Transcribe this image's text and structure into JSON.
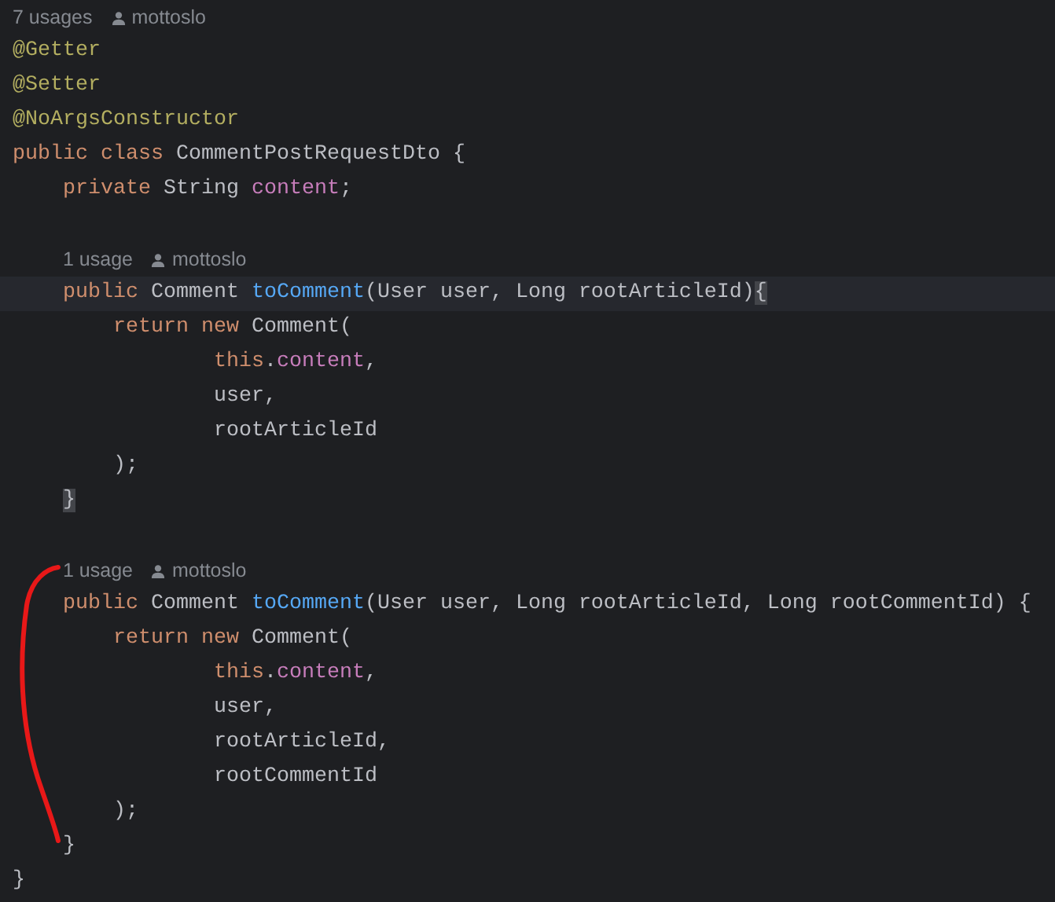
{
  "lines": [
    {
      "kind": "hint",
      "indented": false,
      "usages": "7 usages",
      "author": "mottoslo"
    },
    {
      "kind": "code",
      "current": false,
      "tokens": [
        {
          "kind": "annotation",
          "text": "@Getter",
          "matched": false
        }
      ]
    },
    {
      "kind": "code",
      "current": false,
      "tokens": [
        {
          "kind": "annotation",
          "text": "@Setter",
          "matched": false
        }
      ]
    },
    {
      "kind": "code",
      "current": false,
      "tokens": [
        {
          "kind": "annotation",
          "text": "@NoArgsConstructor",
          "matched": false
        }
      ]
    },
    {
      "kind": "code",
      "current": false,
      "tokens": [
        {
          "kind": "keyword",
          "text": "public class ",
          "matched": false
        },
        {
          "kind": "plain",
          "text": "CommentPostRequestDto {",
          "matched": false
        }
      ]
    },
    {
      "kind": "code",
      "current": false,
      "tokens": [
        {
          "kind": "keyword",
          "text": "    private ",
          "matched": false
        },
        {
          "kind": "plain",
          "text": "String ",
          "matched": false
        },
        {
          "kind": "field",
          "text": "content",
          "matched": false
        },
        {
          "kind": "plain",
          "text": ";",
          "matched": false
        }
      ]
    },
    {
      "kind": "blank"
    },
    {
      "kind": "hint",
      "indented": true,
      "usages": "1 usage",
      "author": "mottoslo"
    },
    {
      "kind": "code",
      "current": true,
      "tokens": [
        {
          "kind": "keyword",
          "text": "    public ",
          "matched": false
        },
        {
          "kind": "plain",
          "text": "Comment ",
          "matched": false
        },
        {
          "kind": "method",
          "text": "toComment",
          "matched": false
        },
        {
          "kind": "plain",
          "text": "(User user, Long rootArticleId)",
          "matched": false
        },
        {
          "kind": "plain",
          "text": "{",
          "matched": true
        }
      ]
    },
    {
      "kind": "code",
      "current": false,
      "tokens": [
        {
          "kind": "keyword",
          "text": "        return new ",
          "matched": false
        },
        {
          "kind": "plain",
          "text": "Comment(",
          "matched": false
        }
      ]
    },
    {
      "kind": "code",
      "current": false,
      "tokens": [
        {
          "kind": "keyword",
          "text": "                this",
          "matched": false
        },
        {
          "kind": "plain",
          "text": ".",
          "matched": false
        },
        {
          "kind": "field",
          "text": "content",
          "matched": false
        },
        {
          "kind": "plain",
          "text": ",",
          "matched": false
        }
      ]
    },
    {
      "kind": "code",
      "current": false,
      "tokens": [
        {
          "kind": "plain",
          "text": "                user,",
          "matched": false
        }
      ]
    },
    {
      "kind": "code",
      "current": false,
      "tokens": [
        {
          "kind": "plain",
          "text": "                rootArticleId",
          "matched": false
        }
      ]
    },
    {
      "kind": "code",
      "current": false,
      "tokens": [
        {
          "kind": "plain",
          "text": "        );",
          "matched": false
        }
      ]
    },
    {
      "kind": "code",
      "current": false,
      "tokens": [
        {
          "kind": "plain",
          "text": "    }",
          "matched": true
        }
      ]
    },
    {
      "kind": "blank"
    },
    {
      "kind": "hint",
      "indented": true,
      "usages": "1 usage",
      "author": "mottoslo"
    },
    {
      "kind": "code",
      "current": false,
      "tokens": [
        {
          "kind": "keyword",
          "text": "    public ",
          "matched": false
        },
        {
          "kind": "plain",
          "text": "Comment ",
          "matched": false
        },
        {
          "kind": "method",
          "text": "toComment",
          "matched": false
        },
        {
          "kind": "plain",
          "text": "(User user, Long rootArticleId, Long rootCommentId) {",
          "matched": false
        }
      ]
    },
    {
      "kind": "code",
      "current": false,
      "tokens": [
        {
          "kind": "keyword",
          "text": "        return new ",
          "matched": false
        },
        {
          "kind": "plain",
          "text": "Comment(",
          "matched": false
        }
      ]
    },
    {
      "kind": "code",
      "current": false,
      "tokens": [
        {
          "kind": "keyword",
          "text": "                this",
          "matched": false
        },
        {
          "kind": "plain",
          "text": ".",
          "matched": false
        },
        {
          "kind": "field",
          "text": "content",
          "matched": false
        },
        {
          "kind": "plain",
          "text": ",",
          "matched": false
        }
      ]
    },
    {
      "kind": "code",
      "current": false,
      "tokens": [
        {
          "kind": "plain",
          "text": "                user,",
          "matched": false
        }
      ]
    },
    {
      "kind": "code",
      "current": false,
      "tokens": [
        {
          "kind": "plain",
          "text": "                rootArticleId,",
          "matched": false
        }
      ]
    },
    {
      "kind": "code",
      "current": false,
      "tokens": [
        {
          "kind": "plain",
          "text": "                rootCommentId",
          "matched": false
        }
      ]
    },
    {
      "kind": "code",
      "current": false,
      "tokens": [
        {
          "kind": "plain",
          "text": "        );",
          "matched": false
        }
      ]
    },
    {
      "kind": "code",
      "current": false,
      "tokens": [
        {
          "kind": "plain",
          "text": "    }",
          "matched": false
        }
      ]
    },
    {
      "kind": "code",
      "current": false,
      "tokens": [
        {
          "kind": "plain",
          "text": "}",
          "matched": false
        }
      ]
    }
  ]
}
